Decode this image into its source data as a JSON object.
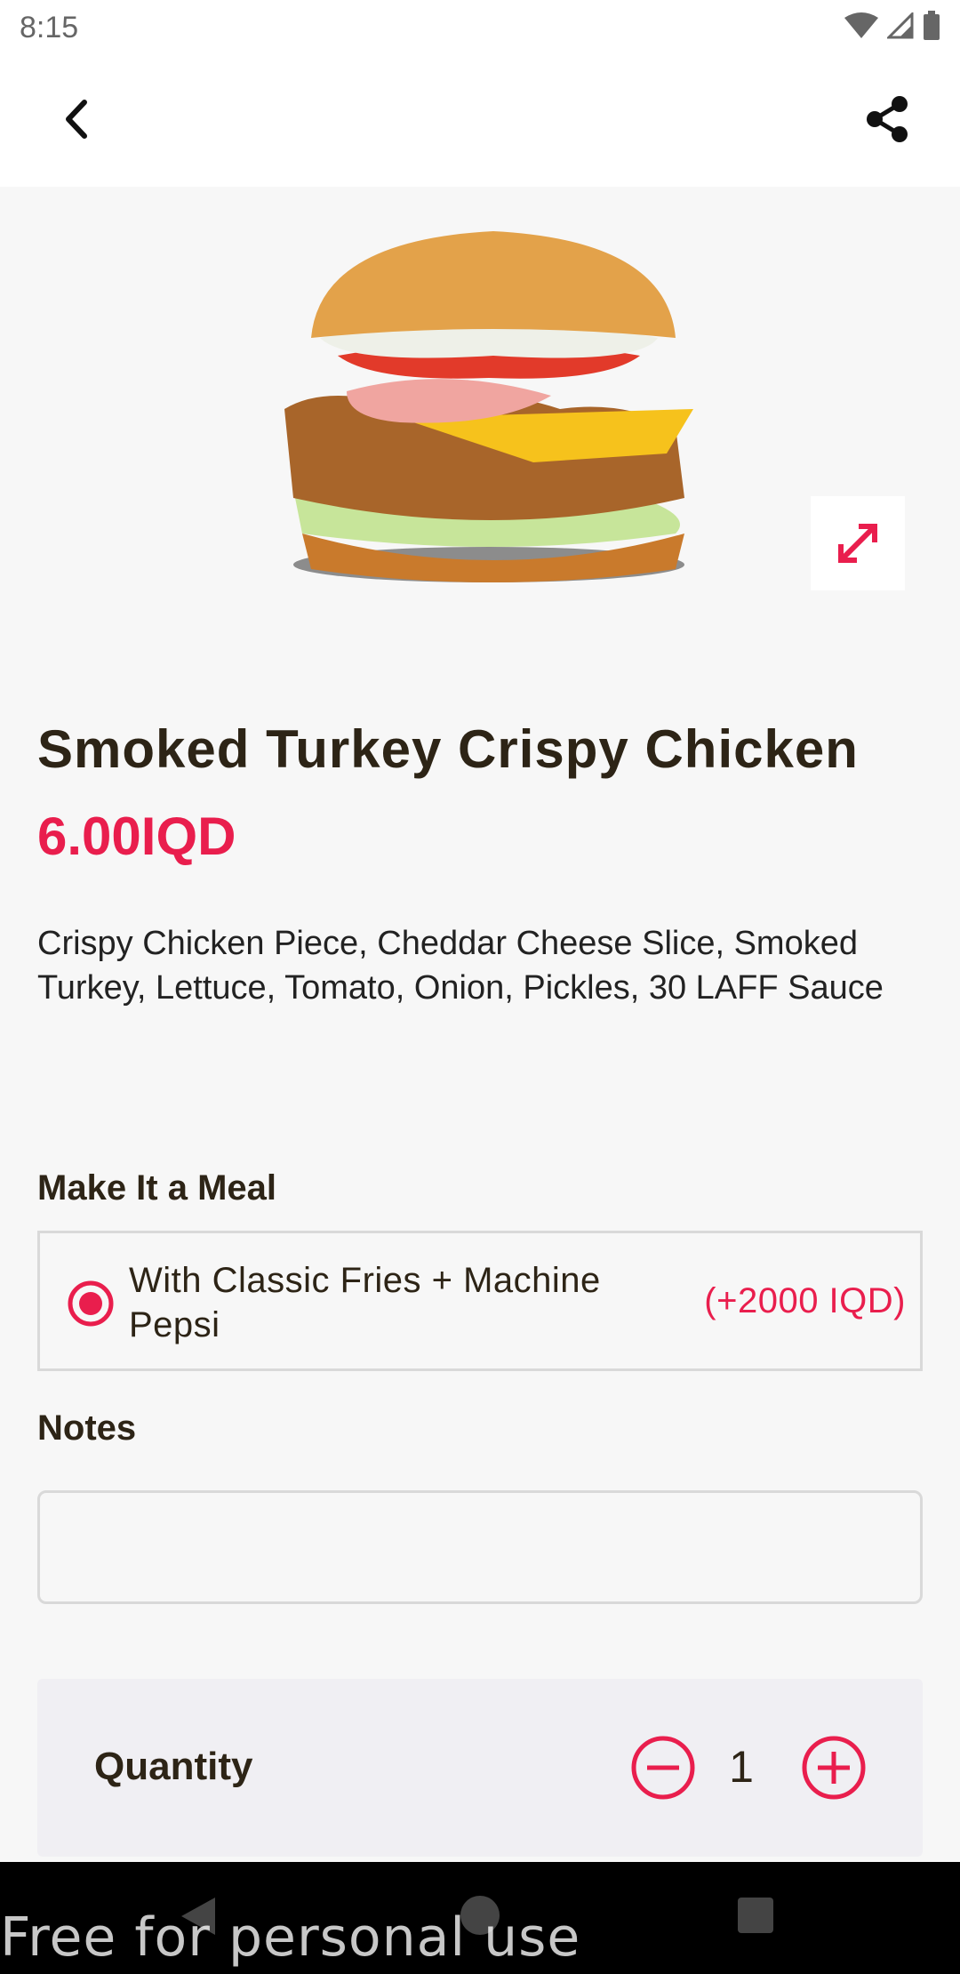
{
  "status_bar": {
    "time": "8:15"
  },
  "product": {
    "title": "Smoked Turkey Crispy Chicken",
    "price": "6.00IQD",
    "description": "Crispy Chicken Piece, Cheddar Cheese Slice, Smoked Turkey, Lettuce, Tomato, Onion, Pickles, 30 LAFF Sauce"
  },
  "meal": {
    "heading": "Make It a Meal",
    "option_label": "With Classic Fries + Machine Pepsi",
    "option_price": "(+2000 IQD)",
    "selected": true
  },
  "notes": {
    "heading": "Notes",
    "value": ""
  },
  "quantity": {
    "label": "Quantity",
    "value": "1"
  },
  "watermark": "Free for personal use",
  "colors": {
    "accent": "#e91e4d",
    "text": "#2d2416",
    "background": "#f7f7f7"
  },
  "icons": {
    "back": "chevron-left-icon",
    "share": "share-icon",
    "expand": "expand-icon",
    "minus": "minus-circle-icon",
    "plus": "plus-circle-icon"
  }
}
